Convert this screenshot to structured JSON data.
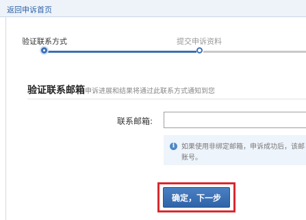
{
  "header": {
    "back_link": "返回申诉首页"
  },
  "steps": [
    {
      "label": "验证联系方式",
      "state": "active"
    },
    {
      "label": "提交申诉资料",
      "state": "inactive"
    }
  ],
  "section": {
    "title": "验证联系邮箱",
    "hint": "申诉进展和结果将通过此联系方式通知到您"
  },
  "form": {
    "email_label": "联系邮箱:",
    "email_value": "",
    "notice_line1": "如果使用非绑定邮箱，申诉成功后，该邮",
    "notice_line2": "账号。"
  },
  "actions": {
    "confirm_label": "确定，下一步"
  },
  "colors": {
    "accent": "#3a6fb0",
    "highlight": "#d8282e",
    "notice_bg": "#eef4fb"
  }
}
